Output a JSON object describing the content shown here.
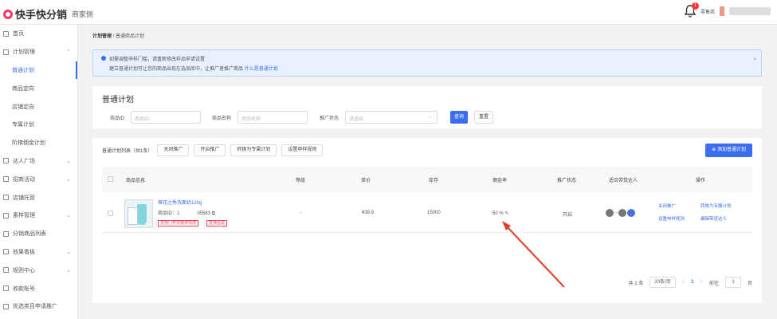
{
  "header": {
    "logo_text": "快手快分销",
    "logo_sub": "商家侧",
    "notification_count": "1",
    "user_label": "零售商"
  },
  "sidebar": {
    "items": [
      {
        "label": "首页",
        "chevron": ""
      },
      {
        "label": "计划管理",
        "chevron": "^"
      },
      {
        "label": "普通计划",
        "sub": true,
        "active": true
      },
      {
        "label": "商品定向",
        "sub": true
      },
      {
        "label": "店铺定向",
        "sub": true
      },
      {
        "label": "专属计划",
        "sub": true
      },
      {
        "label": "阶梯佣金计划",
        "sub": true
      },
      {
        "label": "达人广场",
        "chevron": "v"
      },
      {
        "label": "招商活动",
        "chevron": "v"
      },
      {
        "label": "店铺托管",
        "chevron": ""
      },
      {
        "label": "素样管理",
        "chevron": "v"
      },
      {
        "label": "分销商品列表",
        "chevron": ""
      },
      {
        "label": "效果看板",
        "chevron": "v"
      },
      {
        "label": "规则中心",
        "chevron": "v"
      },
      {
        "label": "收款账号",
        "chevron": ""
      },
      {
        "label": "优选类目申请推广",
        "chevron": ""
      }
    ]
  },
  "breadcrumb": {
    "root": "计划管理",
    "sep": "/",
    "current": "普通商品计划"
  },
  "notice": {
    "line1": "如需调整申样门槛，请重新修改样品申请设置",
    "line2": "建立普通计划可让您的商品出现在选品库中，让推广者推广商品",
    "link": "什么是普通计划",
    "close": "×"
  },
  "filter": {
    "title": "普通计划",
    "product_id_label": "商品ID",
    "product_id_placeholder": "商品ID",
    "product_name_label": "商品名称",
    "product_name_placeholder": "商品名称",
    "status_label": "推广状态",
    "status_placeholder": "请选择",
    "search_label": "查询",
    "reset_label": "重置"
  },
  "list": {
    "title": "普通计划列表（共1条）",
    "buttons": [
      "关闭推广",
      "开启推广",
      "转换为专属计划",
      "设置申样规则"
    ],
    "add_label": "添加普通计划",
    "columns": [
      "商品信息",
      "等级",
      "单价",
      "库存",
      "佣金率",
      "推广状态",
      "适合带货达人",
      "操作"
    ],
    "rows": [
      {
        "name": "蒂花之秀洗面奶120g",
        "id_prefix": "商品ID：1",
        "id_suffix": "05583",
        "tags": [
          "支持门开关接单情境",
          "支持品退"
        ],
        "level": "-",
        "price": "¥39.9",
        "stock": "15000",
        "commission": "50 %",
        "status": "开启",
        "ops": [
          "关闭推广",
          "转换为专属计划",
          "设置申样规则",
          "编辑带货达人"
        ]
      }
    ]
  },
  "pager": {
    "total": "共 1 条",
    "page_size": "20条/页",
    "prev": "<",
    "current": "1",
    "next": ">",
    "goto": "前往",
    "goto_value": "1",
    "page_unit": "页"
  },
  "colors": {
    "accent": "#3a6df0",
    "annotation_arrow": "#e0402a",
    "tag": "#e44455"
  }
}
